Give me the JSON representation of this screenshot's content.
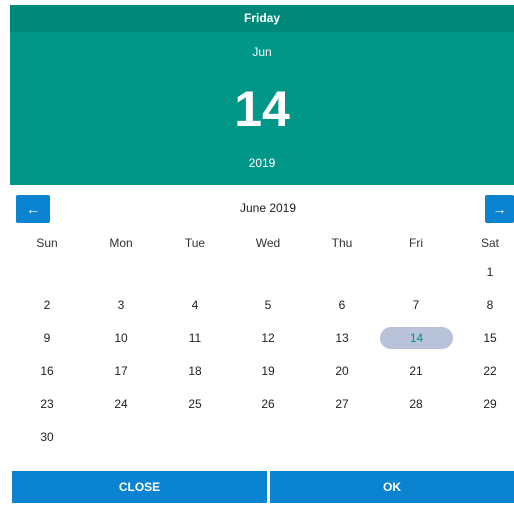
{
  "header": {
    "weekday": "Friday",
    "month": "Jun",
    "day": "14",
    "year": "2019"
  },
  "calendar": {
    "month_label": "June 2019",
    "prev_icon": "←",
    "next_icon": "→",
    "weekdays": [
      "Sun",
      "Mon",
      "Tue",
      "Wed",
      "Thu",
      "Fri",
      "Sat"
    ],
    "selected_day": "14",
    "weeks": [
      [
        "",
        "",
        "",
        "",
        "",
        "",
        "1"
      ],
      [
        "2",
        "3",
        "4",
        "5",
        "6",
        "7",
        "8"
      ],
      [
        "9",
        "10",
        "11",
        "12",
        "13",
        "14",
        "15"
      ],
      [
        "16",
        "17",
        "18",
        "19",
        "20",
        "21",
        "22"
      ],
      [
        "23",
        "24",
        "25",
        "26",
        "27",
        "28",
        "29"
      ],
      [
        "30",
        "",
        "",
        "",
        "",
        "",
        ""
      ]
    ]
  },
  "actions": {
    "close": "CLOSE",
    "ok": "OK"
  },
  "colors": {
    "header": "#009688",
    "header_top": "#00897b",
    "button": "#0a84d0",
    "selected_bg": "#b8c3d9"
  }
}
